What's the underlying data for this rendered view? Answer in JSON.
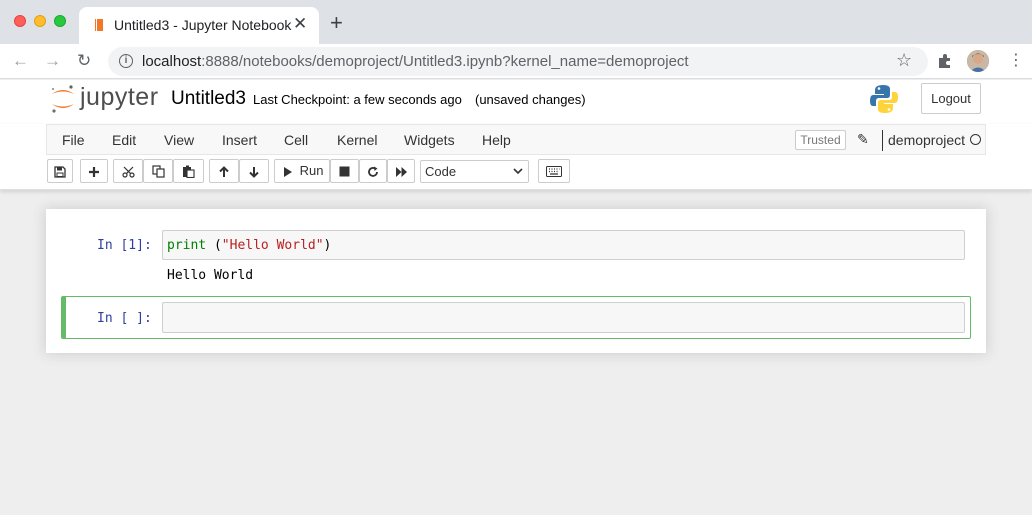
{
  "browser": {
    "tab_title": "Untitled3 - Jupyter Notebook",
    "close_glyph": "✕",
    "new_tab_glyph": "+",
    "back_glyph": "←",
    "forward_glyph": "→",
    "reload_glyph": "↻",
    "url_host": "localhost",
    "url_rest": ":8888/notebooks/demoproject/Untitled3.ipynb?kernel_name=demoproject",
    "star_glyph": "☆",
    "menu_glyph": "⋮"
  },
  "jupyter": {
    "logo_text": "jupyter",
    "notebook_title": "Untitled3",
    "checkpoint": "Last Checkpoint: a few seconds ago",
    "save_status": "(unsaved changes)",
    "logout_label": "Logout"
  },
  "menubar": {
    "items": [
      "File",
      "Edit",
      "View",
      "Insert",
      "Cell",
      "Kernel",
      "Widgets",
      "Help"
    ],
    "trusted_label": "Trusted",
    "kernel_name": "demoproject"
  },
  "toolbar": {
    "run_label": "Run",
    "cell_type": "Code"
  },
  "cells": [
    {
      "prompt": "In [1]:",
      "code_keyword": "print",
      "code_space": " ",
      "code_open": "(",
      "code_string": "\"Hello World\"",
      "code_close": ")",
      "output": "Hello World"
    },
    {
      "prompt": "In [ ]:",
      "code": ""
    }
  ],
  "colors": {
    "edit_mode_border": "#66bb6a",
    "prompt_color": "#303f9f",
    "keyword_color": "#008000",
    "string_color": "#ba2121"
  }
}
